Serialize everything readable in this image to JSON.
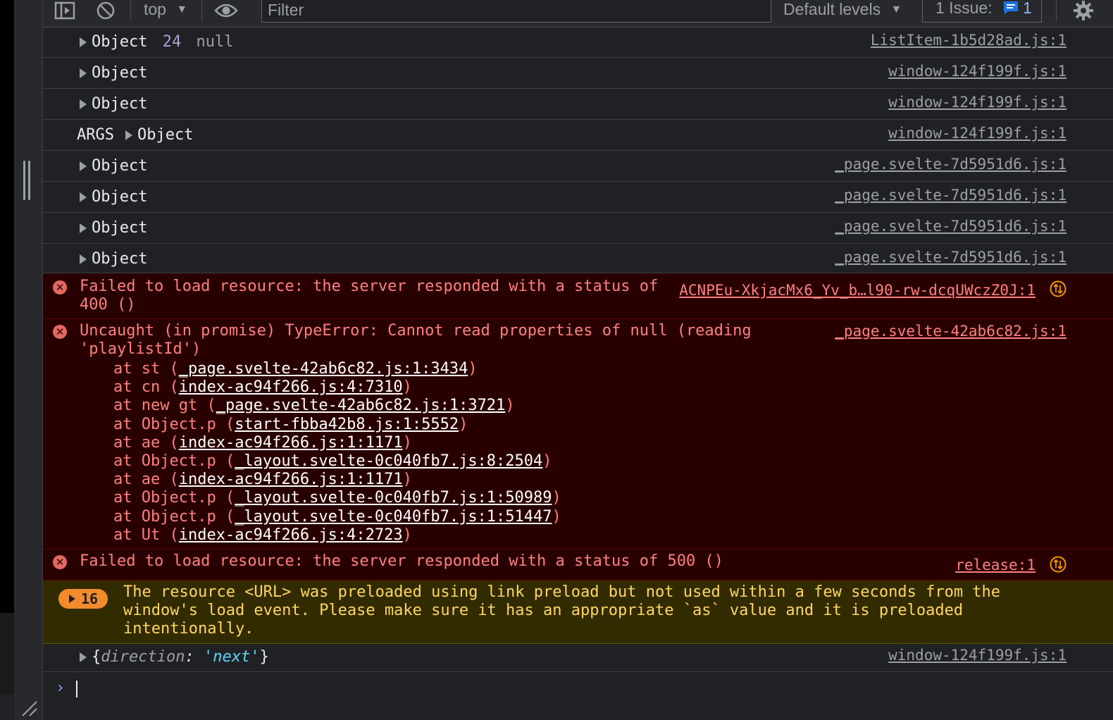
{
  "toolbar": {
    "context": "top",
    "filter_placeholder": "Filter",
    "levels": "Default levels",
    "issues_label": "1 Issue:",
    "issues_count": "1"
  },
  "rows": [
    {
      "prefix": "",
      "text": "Object",
      "extra_num": "24",
      "extra_null": "null",
      "source": "ListItem-1b5d28ad.js:1"
    },
    {
      "prefix": "",
      "text": "Object",
      "source": "window-124f199f.js:1"
    },
    {
      "prefix": "",
      "text": "Object",
      "source": "window-124f199f.js:1"
    },
    {
      "prefix": "ARGS",
      "text": "Object",
      "source": "window-124f199f.js:1"
    },
    {
      "prefix": "",
      "text": "Object",
      "source": "_page.svelte-7d5951d6.js:1"
    },
    {
      "prefix": "",
      "text": "Object",
      "source": "_page.svelte-7d5951d6.js:1"
    },
    {
      "prefix": "",
      "text": "Object",
      "source": "_page.svelte-7d5951d6.js:1"
    },
    {
      "prefix": "",
      "text": "Object",
      "source": "_page.svelte-7d5951d6.js:1"
    }
  ],
  "error1": {
    "line1": "Failed to load resource: the server responded with a status of",
    "line2": "400 ()",
    "source": "ACNPEu-XkjacMx6_Yv_b…l90-rw-dcqUWczZ0J:1"
  },
  "error2": {
    "line1": "Uncaught (in promise) TypeError: Cannot read properties of null (reading",
    "line2": "'playlistId')",
    "source": "_page.svelte-42ab6c82.js:1",
    "stack": [
      {
        "pre": "at st (",
        "link": "_page.svelte-42ab6c82.js:1:3434",
        "post": ")"
      },
      {
        "pre": "at cn (",
        "link": "index-ac94f266.js:4:7310",
        "post": ")"
      },
      {
        "pre": "at new gt (",
        "link": "_page.svelte-42ab6c82.js:1:3721",
        "post": ")"
      },
      {
        "pre": "at Object.p (",
        "link": "start-fbba42b8.js:1:5552",
        "post": ")"
      },
      {
        "pre": "at ae (",
        "link": "index-ac94f266.js:1:1171",
        "post": ")"
      },
      {
        "pre": "at Object.p (",
        "link": "_layout.svelte-0c040fb7.js:8:2504",
        "post": ")"
      },
      {
        "pre": "at ae (",
        "link": "index-ac94f266.js:1:1171",
        "post": ")"
      },
      {
        "pre": "at Object.p (",
        "link": "_layout.svelte-0c040fb7.js:1:50989",
        "post": ")"
      },
      {
        "pre": "at Object.p (",
        "link": "_layout.svelte-0c040fb7.js:1:51447",
        "post": ")"
      },
      {
        "pre": "at Ut (",
        "link": "index-ac94f266.js:4:2723",
        "post": ")"
      }
    ]
  },
  "error3": {
    "line1": "Failed to load resource: the server responded with a status of 500 ()",
    "source": "release:1"
  },
  "warning": {
    "count": "16",
    "line1": "The resource <URL> was preloaded using link preload but not used within a few seconds from the",
    "line2": "window's load event. Please make sure it has an appropriate `as` value and it is preloaded",
    "line3": "intentionally."
  },
  "last_row": {
    "open": "{",
    "key": "direction",
    "colon": ": ",
    "value": "'next'",
    "close": "}",
    "source": "window-124f199f.js:1"
  },
  "colors": {
    "background": "#202124",
    "error_bg": "#290000",
    "error_text": "#ff8080",
    "warning_bg": "#332b00",
    "warning_text": "#fdd663",
    "accent": "#8ab4f8"
  }
}
